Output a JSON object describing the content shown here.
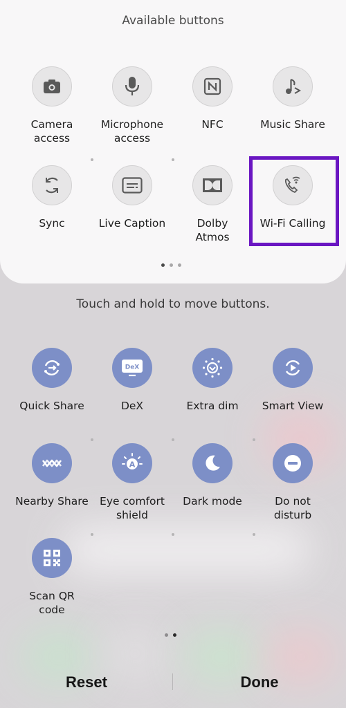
{
  "panel": {
    "title": "Available buttons",
    "buttons": [
      {
        "label": "Camera\naccess",
        "icon": "camera-icon"
      },
      {
        "label": "Microphone\naccess",
        "icon": "microphone-icon"
      },
      {
        "label": "NFC",
        "icon": "nfc-icon"
      },
      {
        "label": "Music Share",
        "icon": "music-share-icon"
      },
      {
        "label": "Sync",
        "icon": "sync-icon"
      },
      {
        "label": "Live Caption",
        "icon": "live-caption-icon"
      },
      {
        "label": "Dolby\nAtmos",
        "icon": "dolby-icon"
      },
      {
        "label": "Wi-Fi Calling",
        "icon": "wifi-calling-icon"
      }
    ],
    "page_dots": {
      "count": 3,
      "active": 0
    }
  },
  "hint": "Touch and hold to move buttons.",
  "active_buttons": [
    {
      "label": "Quick Share",
      "icon": "quick-share-icon"
    },
    {
      "label": "DeX",
      "icon": "dex-icon"
    },
    {
      "label": "Extra dim",
      "icon": "extra-dim-icon"
    },
    {
      "label": "Smart View",
      "icon": "smart-view-icon"
    },
    {
      "label": "Nearby Share",
      "icon": "nearby-share-icon"
    },
    {
      "label": "Eye comfort\nshield",
      "icon": "eye-comfort-icon"
    },
    {
      "label": "Dark mode",
      "icon": "dark-mode-icon"
    },
    {
      "label": "Do not\ndisturb",
      "icon": "do-not-disturb-icon"
    },
    {
      "label": "Scan QR\ncode",
      "icon": "qr-icon"
    }
  ],
  "lower_page_dots": {
    "count": 2,
    "active": 1
  },
  "footer": {
    "reset": "Reset",
    "done": "Done"
  },
  "colors": {
    "active_tile": "#7d8fc7",
    "highlight": "#6a16c2",
    "inactive_tile": "#e7e6e7"
  }
}
